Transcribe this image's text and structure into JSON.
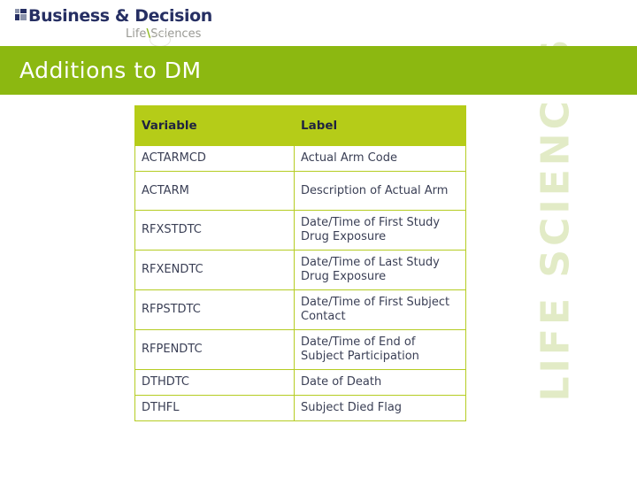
{
  "brand": {
    "logo_title": "Business & Decision",
    "logo_sub_first": "Life",
    "logo_sub_slash": "\\",
    "logo_sub_second": "Sciences",
    "watermark": "LIFE SCIENCES",
    "banner_color": "#8cb811",
    "header_color": "#b5cc18",
    "border_color": "#b5cc23",
    "text_color": "#3a3f55",
    "watermark_color": "#e2ebc6"
  },
  "slide": {
    "title": "Additions to DM"
  },
  "table": {
    "columns": [
      "Variable",
      "Label"
    ],
    "rows": [
      {
        "variable": "ACTARMCD",
        "label": "Actual Arm Code"
      },
      {
        "variable": "ACTARM",
        "label": "Description of Actual Arm"
      },
      {
        "variable": "RFXSTDTC",
        "label": "Date/Time of First Study Drug Exposure"
      },
      {
        "variable": "RFXENDTC",
        "label": "Date/Time of Last Study Drug Exposure"
      },
      {
        "variable": "RFPSTDTC",
        "label": "Date/Time of First Subject Contact"
      },
      {
        "variable": "RFPENDTC",
        "label": "Date/Time of End of Subject Participation"
      },
      {
        "variable": "DTHDTC",
        "label": "Date of Death"
      },
      {
        "variable": "DTHFL",
        "label": "Subject Died Flag"
      }
    ]
  }
}
